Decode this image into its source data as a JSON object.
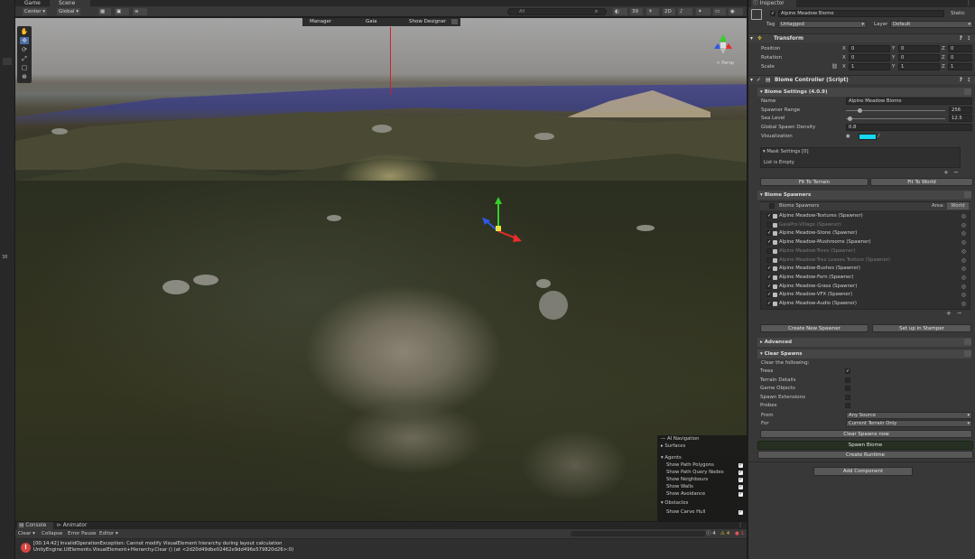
{
  "scene_tabs": {
    "game": "Game",
    "scene": "Scene"
  },
  "scene_toolbar": {
    "pivot": "Center",
    "space": "Global",
    "search_placeholder": "All",
    "view_count": "39",
    "mode_2d": "2D"
  },
  "gaia_bar": {
    "manager": "Manager",
    "title": "Gaia",
    "show_designer": "Show Designer"
  },
  "viewport": {
    "perspective": "< Persp"
  },
  "ai_nav": {
    "title": "AI Navigation",
    "surfaces": "Surfaces",
    "agents": "Agents",
    "agent_items": [
      {
        "label": "Show Path Polygons",
        "checked": true
      },
      {
        "label": "Show Path Query Nodes",
        "checked": true
      },
      {
        "label": "Show Neighbours",
        "checked": true
      },
      {
        "label": "Show Walls",
        "checked": true
      },
      {
        "label": "Show Avoidance",
        "checked": true
      }
    ],
    "obstacles": "Obstacles",
    "obstacle_items": [
      {
        "label": "Show Carve Hull",
        "checked": true
      }
    ]
  },
  "console": {
    "tab_console": "Console",
    "tab_animator": "Animator",
    "clear": "Clear",
    "collapse": "Collapse",
    "error_pause": "Error Pause",
    "editor": "Editor",
    "warn_count": "4",
    "log_count": "4",
    "error_count": "1",
    "message_line1": "[00:14:42] InvalidOperationException: Cannot modify VisualElement hierarchy during layout calculation",
    "message_line2": "UnityEngine.UIElements.VisualElement+Hierarchy.Clear () (at <2d20d49dbe02462e9dd496e579820d26>:0)"
  },
  "inspector": {
    "tab": "Inspector",
    "object_name": "Alpine Meadow Biome",
    "static_label": "Static",
    "tag_label": "Tag",
    "tag_value": "Untagged",
    "layer_label": "Layer",
    "layer_value": "Default",
    "transform": {
      "title": "Transform",
      "position_label": "Position",
      "rotation_label": "Rotation",
      "scale_label": "Scale",
      "position": {
        "x": "0",
        "y": "0",
        "z": "0"
      },
      "rotation": {
        "x": "0",
        "y": "0",
        "z": "0"
      },
      "scale": {
        "x": "1",
        "y": "1",
        "z": "1"
      }
    },
    "biome_controller": {
      "title": "Biome Controller (Script)",
      "settings_title": "Biome Settings",
      "version": "(4.0.9)",
      "name_label": "Name",
      "name_value": "Alpine Meadow Biome",
      "spawner_range_label": "Spawner Range",
      "spawner_range_value": "256",
      "sea_level_label": "Sea Level",
      "sea_level_value": "12.5",
      "density_label": "Global Spawn Density",
      "density_value": "0.8",
      "visualization_label": "Visualization",
      "visualization_color": "#16d8f0",
      "mask_settings": "Mask Settings [0]",
      "list_empty": "List is Empty",
      "fit_terrain": "Fit To Terrain",
      "fit_world": "Fit To World"
    },
    "spawners": {
      "title": "Biome Spawners",
      "list_header": "Biome Spawners",
      "area_label": "Area:",
      "area_value": "World",
      "items": [
        {
          "name": "Alpine Meadow-Textures (Spawner)",
          "checked": true,
          "dim": false
        },
        {
          "name": "GaiaPro-Village (Spawner)",
          "checked": false,
          "dim": true
        },
        {
          "name": "Alpine Meadow-Stone (Spawner)",
          "checked": true,
          "dim": false
        },
        {
          "name": "Alpine Meadow-Mushrooms (Spawner)",
          "checked": true,
          "dim": false
        },
        {
          "name": "Alpine Meadow-Trees (Spawner)",
          "checked": false,
          "dim": true
        },
        {
          "name": "Alpine Meadow-Tree Leaves Texture (Spawner)",
          "checked": false,
          "dim": true
        },
        {
          "name": "Alpine Meadow-Bushes (Spawner)",
          "checked": true,
          "dim": false
        },
        {
          "name": "Alpine Meadow-Fern (Spawner)",
          "checked": true,
          "dim": false
        },
        {
          "name": "Alpine Meadow-Grass (Spawner)",
          "checked": true,
          "dim": false
        },
        {
          "name": "Alpine Meadow-VFX (Spawner)",
          "checked": true,
          "dim": false
        },
        {
          "name": "Alpine Meadow-Audio (Spawner)",
          "checked": true,
          "dim": false
        }
      ],
      "create_new": "Create New Spawner",
      "setup_stamper": "Set up in Stamper"
    },
    "advanced": "Advanced",
    "clear_spawns": {
      "title": "Clear Spawns",
      "clear_following": "Clear the following:",
      "options": [
        {
          "label": "Trees",
          "checked": true
        },
        {
          "label": "Terrain Details",
          "checked": false
        },
        {
          "label": "Game Objects",
          "checked": false
        },
        {
          "label": "Spawn Extensions",
          "checked": false
        },
        {
          "label": "Probes",
          "checked": false
        }
      ],
      "from_label": "From",
      "from_value": "Any Source",
      "for_label": "For",
      "for_value": "Current Terrain Only",
      "clear_now": "Clear Spawns now"
    },
    "spawn_biome": "Spawn Biome",
    "create_runtime": "Create Runtime",
    "add_component": "Add Component"
  },
  "colors": {
    "accent_green": "#3a4a2a",
    "error_red": "#d8453f",
    "checked_blue": "#4d7ec9"
  }
}
